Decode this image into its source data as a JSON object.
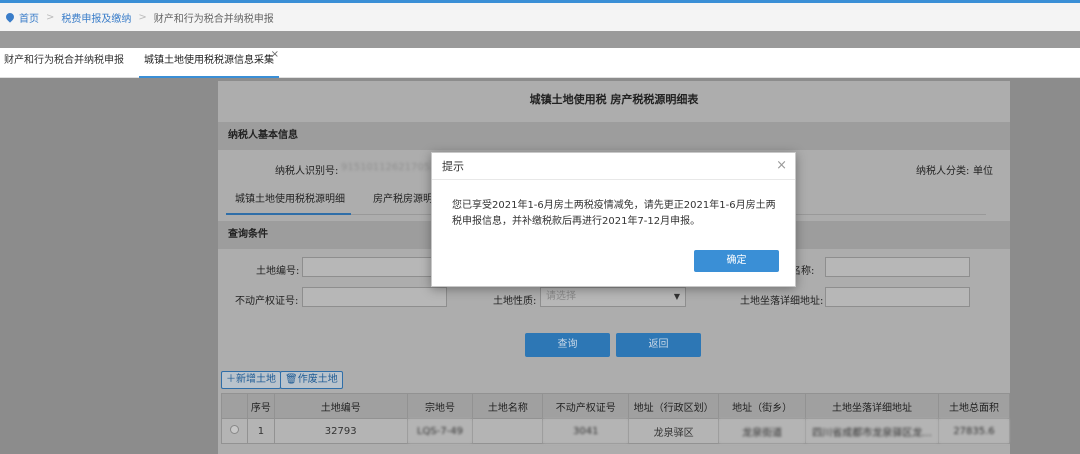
{
  "breadcrumb": {
    "home": "首页",
    "level1": "税费申报及缴纳",
    "level2": "财产和行为税合并纳税申报"
  },
  "tabs": [
    {
      "label": "财产和行为税合并纳税申报"
    },
    {
      "label": "城镇土地使用税税源信息采集",
      "close": "×"
    }
  ],
  "page": {
    "title": "城镇土地使用税  房产税税源明细表",
    "basic_info_header": "纳税人基本信息",
    "taxpayer_id_label": "纳税人识别号:",
    "taxpayer_id_value": "91510112621705291",
    "taxpayer_type_label": "纳税人分类:",
    "taxpayer_type_value": "单位",
    "subtabs": [
      "城镇土地使用税税源明细",
      "房产税房源明细"
    ],
    "query_header": "查询条件",
    "land_no_label": "土地编号:",
    "land_name_label": "名称:",
    "property_cert_label": "不动产权证号:",
    "land_nature_label": "土地性质:",
    "land_nature_placeholder": "请选择",
    "land_address_label": "土地坐落详细地址:",
    "query_btn": "查询",
    "back_btn": "返回",
    "add_land_btn": "新增土地",
    "void_land_btn": "作废土地"
  },
  "table": {
    "headers": [
      "",
      "序号",
      "土地编号",
      "宗地号",
      "土地名称",
      "不动产权证号",
      "地址（行政区划）",
      "地址（街乡）",
      "土地坐落详细地址",
      "土地总面积"
    ],
    "rows": [
      {
        "index": "1",
        "land_no": "32793",
        "parcel_no": "LQS-7-49",
        "land_name": "",
        "cert_no": "3041",
        "district": "龙泉驿区",
        "street": "龙泉街道",
        "address": "四川省成都市龙泉驿区龙...",
        "area": "27835.6"
      }
    ]
  },
  "modal": {
    "title": "提示",
    "close": "×",
    "message": "您已享受2021年1-6月房土两税疫情减免，请先更正2021年1-6月房土两税申报信息，并补缴税款后再进行2021年7-12月申报。",
    "ok": "确定"
  },
  "colors": {
    "accent": "#3a8fd6",
    "button": "#2d77b5"
  }
}
